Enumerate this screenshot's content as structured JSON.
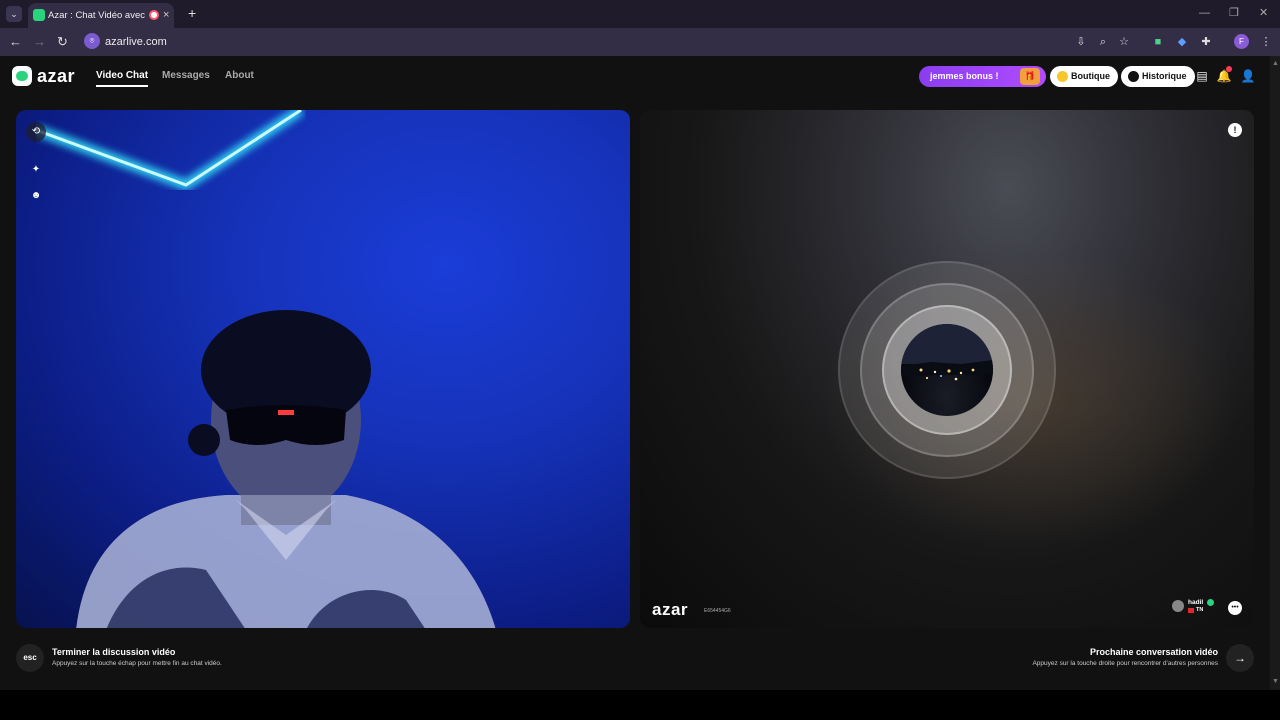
{
  "browser": {
    "tab_title": "Azar : Chat Vidéo avec de n",
    "tab_close": "×",
    "new_tab": "+",
    "tab_list": "⌄",
    "url": "azarlive.com",
    "window_controls": [
      "—",
      "❐",
      "✕"
    ],
    "nav": {
      "back": "←",
      "forward": "→",
      "reload": "↻"
    },
    "profile_initial": "F"
  },
  "header": {
    "logo": "azar",
    "nav": [
      {
        "label": "Video Chat",
        "active": true
      },
      {
        "label": "Messages",
        "active": false
      },
      {
        "label": "About",
        "active": false
      }
    ],
    "bonus_label": "jemmes bonus !",
    "shop_label": "Boutique",
    "history_label": "Historique"
  },
  "left_panel": {
    "tools": [
      "swap-camera-icon",
      "magic-wand-icon",
      "sticker-icon"
    ]
  },
  "right_panel": {
    "watermark_logo": "azar",
    "watermark_id": "E654454G6",
    "partner_name": "hadil",
    "partner_country": "TN"
  },
  "footer": {
    "esc_key": "esc",
    "end_title": "Terminer la discussion vidéo",
    "end_desc": "Appuyez sur la touche échap pour mettre fin au chat vidéo.",
    "next_title": "Prochaine conversation vidéo",
    "next_desc": "Appuyez sur la touche droite pour rencontrer d'autres personnes",
    "next_arrow": "→"
  },
  "colors": {
    "brand_green": "#2bd47c",
    "bonus_purple": "#8a3ef0",
    "browser_bg": "#332d45"
  }
}
